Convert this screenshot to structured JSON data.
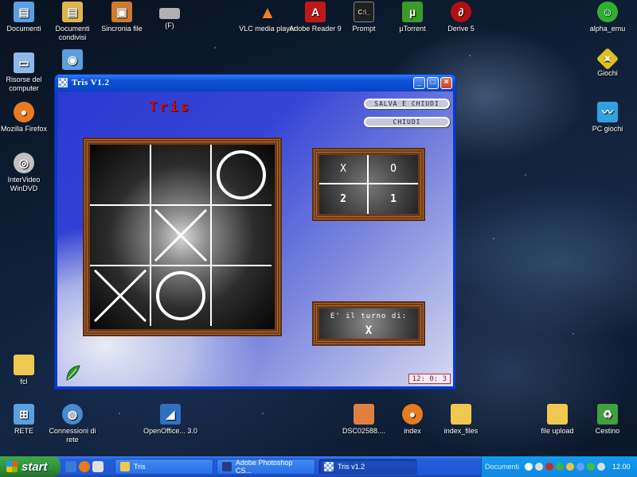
{
  "desktop": {
    "icons_left": [
      {
        "label": "Documenti",
        "icon": "documents-folder-icon",
        "color": "#5aa0e0"
      },
      {
        "label": "Documenti condivisi",
        "icon": "shared-documents-icon",
        "color": "#e0b450"
      },
      {
        "label": "Sincronia file",
        "icon": "briefcase-icon",
        "color": "#d07a30"
      },
      {
        "label": "(F)",
        "icon": "drive-icon",
        "color": "#b0b0b0"
      },
      {
        "label": "Risorse del computer",
        "icon": "my-computer-icon",
        "color": "#8fb8e8"
      },
      {
        "label": "",
        "icon": "network-icon",
        "color": "#5aa0e0"
      },
      {
        "label": "Mozilla Firefox",
        "icon": "firefox-icon",
        "color": "#e87a20"
      },
      {
        "label": "InterVideo WinDVD",
        "icon": "windvd-icon",
        "color": "#c0c0c0"
      },
      {
        "label": "fcl",
        "icon": "folder-icon",
        "color": "#f0c850"
      },
      {
        "label": "RETE",
        "icon": "network-places-icon",
        "color": "#5aa0e0"
      },
      {
        "label": "Connessioni di rete",
        "icon": "network-connections-icon",
        "color": "#4a8ad0"
      },
      {
        "label": "OpenOffice... 3.0",
        "icon": "openoffice-icon",
        "color": "#3070c0"
      }
    ],
    "icons_top": [
      {
        "label": "VLC media player",
        "icon": "vlc-icon",
        "color": "#f08020"
      },
      {
        "label": "Adobe Reader 9",
        "icon": "adobe-reader-icon",
        "color": "#c01818"
      },
      {
        "label": "Prompt",
        "icon": "command-prompt-icon",
        "color": "#202020"
      },
      {
        "label": "µTorrent",
        "icon": "utorrent-icon",
        "color": "#3a9a2a"
      },
      {
        "label": "Derive 5",
        "icon": "derive-icon",
        "color": "#b01010"
      },
      {
        "label": "alpha_emu",
        "icon": "alpha-emu-icon",
        "color": "#30b030"
      }
    ],
    "icons_right": [
      {
        "label": "Giochi",
        "icon": "games-icon",
        "color": "#e0c020"
      },
      {
        "label": "PC giochi",
        "icon": "pc-games-icon",
        "color": "#30a0e0"
      },
      {
        "label": "file upload",
        "icon": "folder-icon",
        "color": "#f0c850"
      },
      {
        "label": "Cestino",
        "icon": "recycle-bin-icon",
        "color": "#40a040"
      }
    ],
    "icons_bottom": [
      {
        "label": "DSC02588....",
        "icon": "image-file-icon",
        "color": "#e08040"
      },
      {
        "label": "index",
        "icon": "firefox-icon",
        "color": "#e87a20"
      },
      {
        "label": "index_files",
        "icon": "folder-icon",
        "color": "#f0c850"
      }
    ]
  },
  "window": {
    "title": "Tris   V1.2",
    "logo": "Tris",
    "buttons": {
      "save_close": "SALVA E CHIUDI",
      "close": "CHIUDI",
      "minimize": "_",
      "maximize": "□",
      "x": "×"
    },
    "board": [
      [
        "",
        "",
        "O"
      ],
      [
        "",
        "X",
        ""
      ],
      [
        "X",
        "O",
        ""
      ]
    ],
    "score": {
      "player1_symbol": "X",
      "player2_symbol": "O",
      "player1_score": "2",
      "player2_score": "1"
    },
    "turn": {
      "label": "E' il turno di:",
      "value": "X"
    },
    "clock": "12: 0: 3"
  },
  "taskbar": {
    "start_label": "start",
    "tasks": [
      {
        "label": "Tris",
        "icon": "folder-icon",
        "color": "#f0c850",
        "active": false
      },
      {
        "label": "Adobe Photoshop CS...",
        "icon": "photoshop-icon",
        "color": "#2a3a80",
        "active": false
      },
      {
        "label": "Tris   v1.2",
        "icon": "tris-app-icon",
        "color": "#c0d0f0",
        "active": true
      }
    ],
    "tray_label": "Documenti",
    "time": "12.00"
  },
  "colors": {
    "window_blue": "#0a3ac8",
    "logo_red": "#c01010",
    "frame_brown": "#6e3918"
  }
}
